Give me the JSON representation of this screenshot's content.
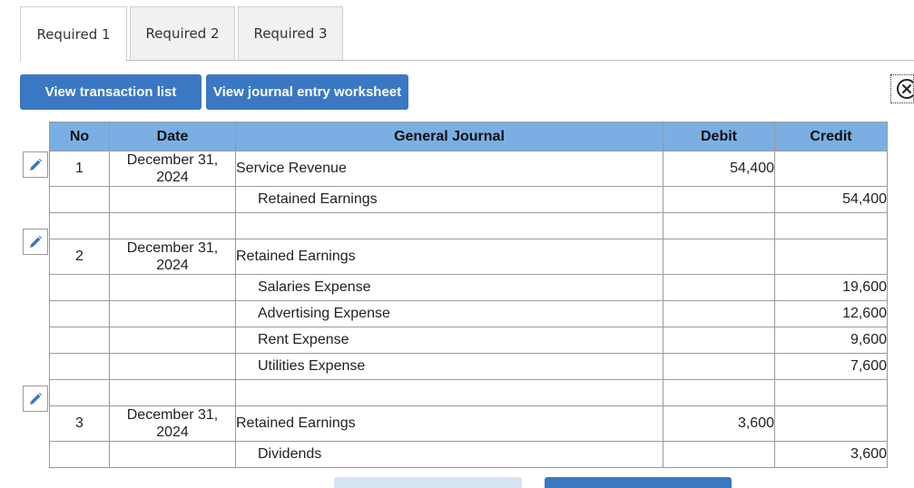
{
  "tabs": [
    {
      "label": "Required 1",
      "active": true
    },
    {
      "label": "Required 2",
      "active": false
    },
    {
      "label": "Required 3",
      "active": false
    }
  ],
  "buttons": {
    "view_transaction_list": "View transaction list",
    "view_journal_entry_worksheet": "View journal entry worksheet"
  },
  "table": {
    "headers": {
      "no": "No",
      "date": "Date",
      "account": "General Journal",
      "debit": "Debit",
      "credit": "Credit"
    },
    "rows": [
      {
        "no": "1",
        "date": "December 31,\n2024",
        "account": "Service Revenue",
        "debit": "54,400",
        "credit": ""
      },
      {
        "no": "",
        "date": "",
        "account": "Retained Earnings",
        "debit": "",
        "credit": "54,400"
      },
      {
        "no": "",
        "date": "",
        "account": "",
        "debit": "",
        "credit": ""
      },
      {
        "no": "2",
        "date": "December 31,\n2024",
        "account": "Retained Earnings",
        "debit": "",
        "credit": ""
      },
      {
        "no": "",
        "date": "",
        "account": "Salaries Expense",
        "debit": "",
        "credit": "19,600"
      },
      {
        "no": "",
        "date": "",
        "account": "Advertising Expense",
        "debit": "",
        "credit": "12,600"
      },
      {
        "no": "",
        "date": "",
        "account": "Rent Expense",
        "debit": "",
        "credit": "9,600"
      },
      {
        "no": "",
        "date": "",
        "account": "Utilities Expense",
        "debit": "",
        "credit": "7,600"
      },
      {
        "no": "",
        "date": "",
        "account": "",
        "debit": "",
        "credit": ""
      },
      {
        "no": "3",
        "date": "December 31,\n2024",
        "account": "Retained Earnings",
        "debit": "3,600",
        "credit": ""
      },
      {
        "no": "",
        "date": "",
        "account": "Dividends",
        "debit": "",
        "credit": "3,600"
      }
    ]
  },
  "colors": {
    "accent": "#3b78c4",
    "header_bg": "#7bafe3",
    "tab_bg": "#f1f1f1",
    "border": "#9a9a9a"
  },
  "icons": {
    "edit": "pencil-icon",
    "close": "close-circle-icon"
  }
}
